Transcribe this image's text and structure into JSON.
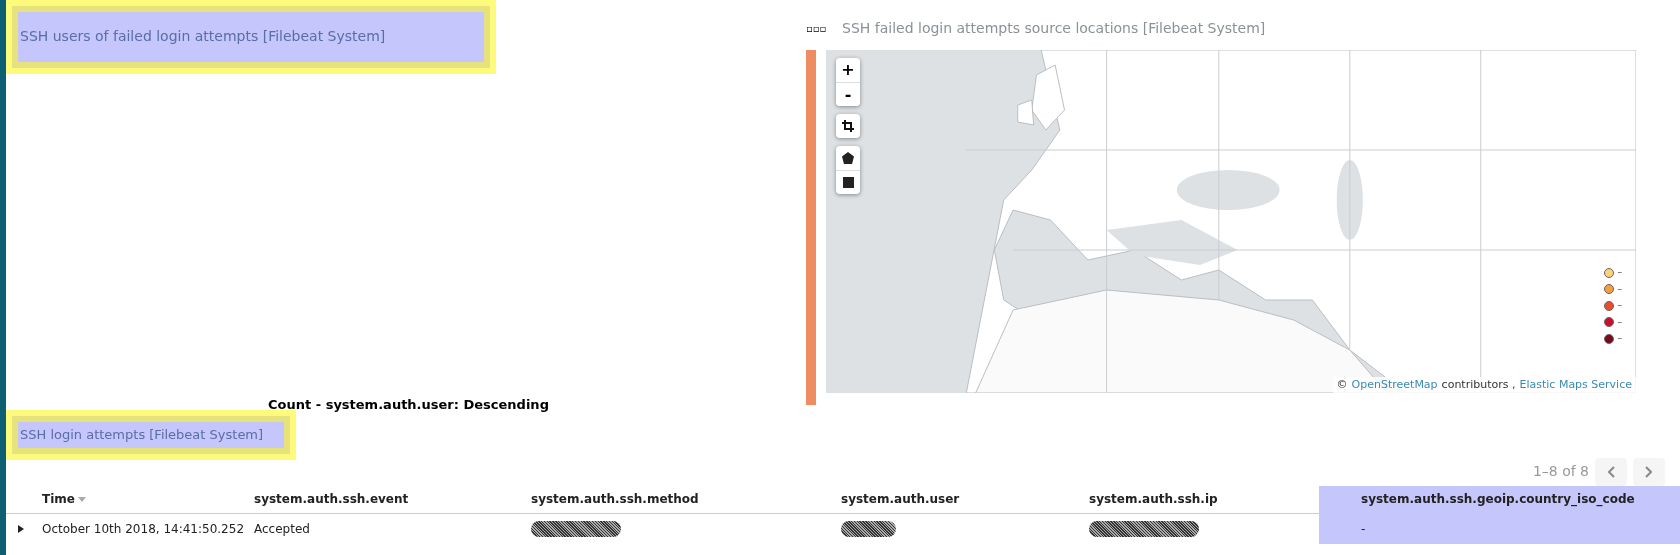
{
  "panels": [
    {
      "title": "SSH users of failed login attempts [Filebeat System]",
      "highlighted": true
    },
    {
      "title": "SSH failed login attempts source locations [Filebeat System]",
      "highlighted": false
    }
  ],
  "panel_menu": "▫▫▫",
  "map": {
    "kind": "picture",
    "controls": [
      "+",
      "-"
    ],
    "legend": [
      {
        "label": "–",
        "color": "#fcd27c"
      },
      {
        "label": "–",
        "color": "#f5a03c"
      },
      {
        "label": "–",
        "color": "#ee4b2b"
      },
      {
        "label": "–",
        "color": "#c8102e"
      },
      {
        "label": "–",
        "color": "#7a0a1a"
      }
    ],
    "attribution": {
      "prefix": "©",
      "link1": "OpenStreetMap",
      "middle": "contributors ,",
      "link2": "Elastic Maps Service"
    }
  },
  "sort_label": "Count - system.auth.user: Descending",
  "search": {
    "title": "SSH login attempts [Filebeat System]",
    "highlighted": true,
    "pagination": "1–8 of 8"
  },
  "table": {
    "columns": [
      {
        "label": "Time",
        "sorted": true,
        "highlighted": false
      },
      {
        "label": "system.auth.ssh.event",
        "sorted": false,
        "highlighted": false
      },
      {
        "label": "system.auth.ssh.method",
        "sorted": false,
        "highlighted": false
      },
      {
        "label": "system.auth.user",
        "sorted": false,
        "highlighted": false
      },
      {
        "label": "system.auth.ssh.ip",
        "sorted": false,
        "highlighted": false
      },
      {
        "label": "system.auth.ssh.geoip.country_iso_code",
        "sorted": false,
        "highlighted": true
      }
    ],
    "rows": [
      {
        "expanded": false,
        "cells": [
          {
            "kind": "text",
            "text": "October 10th 2018, 14:41:50.252"
          },
          {
            "kind": "text",
            "text": "Accepted"
          },
          {
            "kind": "redacted"
          },
          {
            "kind": "redacted"
          },
          {
            "kind": "redacted"
          },
          {
            "kind": "text",
            "text": "-"
          }
        ]
      }
    ]
  }
}
